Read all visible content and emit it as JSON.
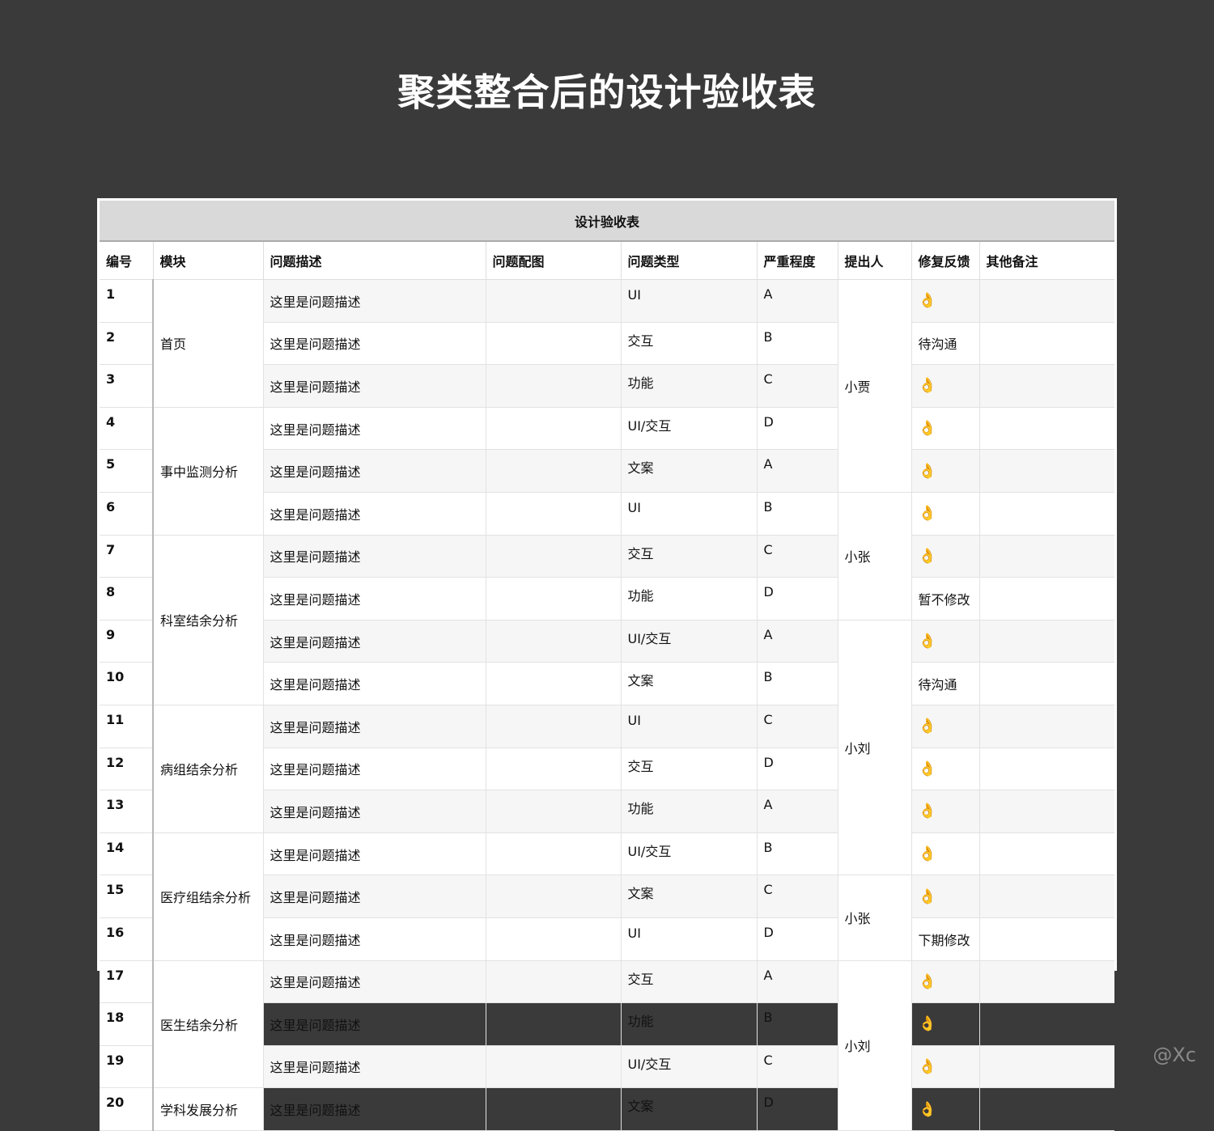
{
  "page_title": "聚类整合后的设计验收表",
  "table_title": "设计验收表",
  "columns": [
    "编号",
    "模块",
    "问题描述",
    "问题配图",
    "问题类型",
    "严重程度",
    "提出人",
    "修复反馈",
    "其他备注"
  ],
  "modules": {
    "m1": "首页",
    "m2": "事中监测分析",
    "m3": "科室结余分析",
    "m4": "病组结余分析",
    "m5": "医疗组结余分析",
    "m6": "医生结余分析",
    "m7": "学科发展分析"
  },
  "people": {
    "p1": "小贾",
    "p2": "小张",
    "p3": "小刘",
    "p4": "小张",
    "p5": "小刘"
  },
  "ok_icon": "👌",
  "rows": [
    {
      "id": "1",
      "desc": "这里是问题描述",
      "type": "UI",
      "severity": "A",
      "feedback": "👌"
    },
    {
      "id": "2",
      "desc": "这里是问题描述",
      "type": "交互",
      "severity": "B",
      "feedback": "待沟通"
    },
    {
      "id": "3",
      "desc": "这里是问题描述",
      "type": "功能",
      "severity": "C",
      "feedback": "👌"
    },
    {
      "id": "4",
      "desc": "这里是问题描述",
      "type": "UI/交互",
      "severity": "D",
      "feedback": "👌"
    },
    {
      "id": "5",
      "desc": "这里是问题描述",
      "type": "文案",
      "severity": "A",
      "feedback": "👌"
    },
    {
      "id": "6",
      "desc": "这里是问题描述",
      "type": "UI",
      "severity": "B",
      "feedback": "👌"
    },
    {
      "id": "7",
      "desc": "这里是问题描述",
      "type": "交互",
      "severity": "C",
      "feedback": "👌"
    },
    {
      "id": "8",
      "desc": "这里是问题描述",
      "type": "功能",
      "severity": "D",
      "feedback": "暂不修改"
    },
    {
      "id": "9",
      "desc": "这里是问题描述",
      "type": "UI/交互",
      "severity": "A",
      "feedback": "👌"
    },
    {
      "id": "10",
      "desc": "这里是问题描述",
      "type": "文案",
      "severity": "B",
      "feedback": "待沟通"
    },
    {
      "id": "11",
      "desc": "这里是问题描述",
      "type": "UI",
      "severity": "C",
      "feedback": "👌"
    },
    {
      "id": "12",
      "desc": "这里是问题描述",
      "type": "交互",
      "severity": "D",
      "feedback": "👌"
    },
    {
      "id": "13",
      "desc": "这里是问题描述",
      "type": "功能",
      "severity": "A",
      "feedback": "👌"
    },
    {
      "id": "14",
      "desc": "这里是问题描述",
      "type": "UI/交互",
      "severity": "B",
      "feedback": "👌"
    },
    {
      "id": "15",
      "desc": "这里是问题描述",
      "type": "文案",
      "severity": "C",
      "feedback": "👌"
    },
    {
      "id": "16",
      "desc": "这里是问题描述",
      "type": "UI",
      "severity": "D",
      "feedback": "下期修改"
    },
    {
      "id": "17",
      "desc": "这里是问题描述",
      "type": "交互",
      "severity": "A",
      "feedback": "👌"
    },
    {
      "id": "18",
      "desc": "这里是问题描述",
      "type": "功能",
      "severity": "B",
      "feedback": "👌"
    },
    {
      "id": "19",
      "desc": "这里是问题描述",
      "type": "UI/交互",
      "severity": "C",
      "feedback": "👌"
    },
    {
      "id": "20",
      "desc": "这里是问题描述",
      "type": "文案",
      "severity": "D",
      "feedback": "👌"
    }
  ],
  "watermark": "@Xc"
}
